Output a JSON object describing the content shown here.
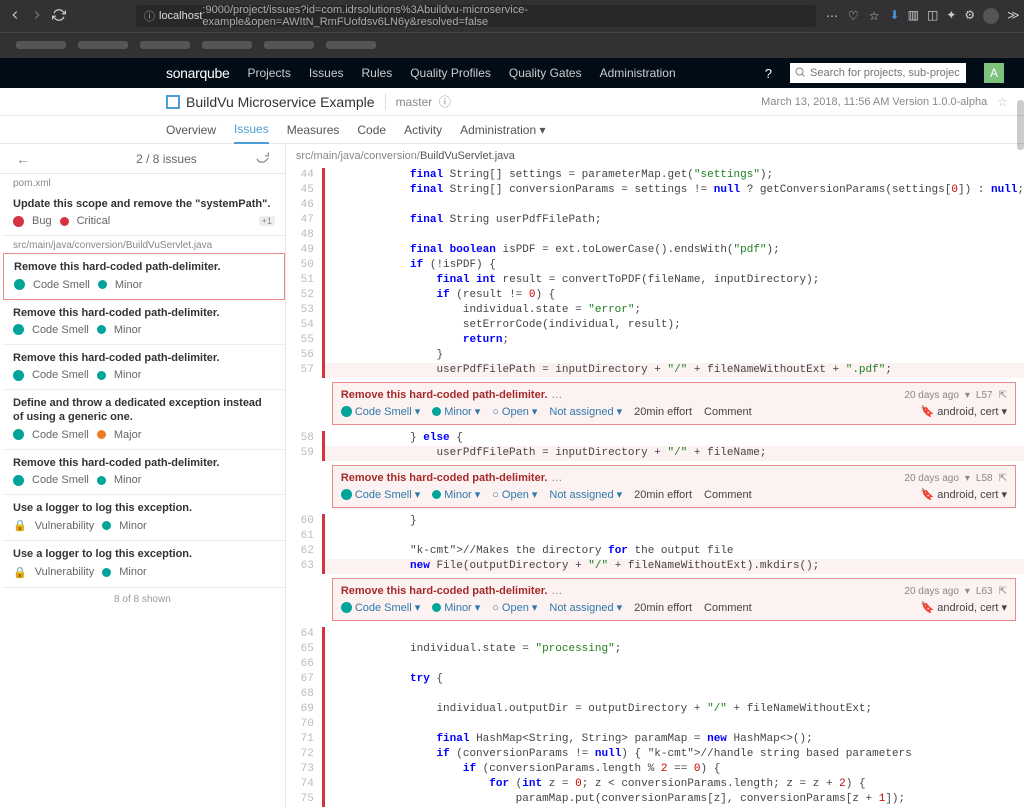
{
  "browser": {
    "url_prefix": "localhost",
    "url_rest": ":9000/project/issues?id=com.idrsolutions%3Abuildvu-microservice-example&open=AWItN_RmFUofdsv6LN6y&resolved=false"
  },
  "nav": {
    "brand": "sonarqube",
    "items": [
      "Projects",
      "Issues",
      "Rules",
      "Quality Profiles",
      "Quality Gates",
      "Administration"
    ],
    "search_placeholder": "Search for projects, sub-projects and files...",
    "avatar_letter": "A"
  },
  "project": {
    "name": "BuildVu Microservice Example",
    "branch": "master",
    "meta": "March 13, 2018, 11:56 AM   Version 1.0.0-alpha"
  },
  "subnav": [
    "Overview",
    "Issues",
    "Measures",
    "Code",
    "Activity",
    "Administration ▾"
  ],
  "issues_header": {
    "count": "2 / 8 issues"
  },
  "sidebar": {
    "file1": "pom.xml",
    "file2": "src/main/java/conversion/BuildVuServlet.java",
    "items": [
      {
        "title": "Update this scope and remove the \"systemPath\".",
        "type": "Bug",
        "type_icon": "red",
        "sev": "Critical",
        "sev_icon": "red",
        "badge": "+1"
      },
      {
        "title": "Remove this hard-coded path-delimiter.",
        "type": "Code Smell",
        "type_icon": "teal",
        "sev": "Minor",
        "sev_icon": "teal",
        "selected": true
      },
      {
        "title": "Remove this hard-coded path-delimiter.",
        "type": "Code Smell",
        "type_icon": "teal",
        "sev": "Minor",
        "sev_icon": "teal"
      },
      {
        "title": "Remove this hard-coded path-delimiter.",
        "type": "Code Smell",
        "type_icon": "teal",
        "sev": "Minor",
        "sev_icon": "teal"
      },
      {
        "title": "Define and throw a dedicated exception instead of using a generic one.",
        "type": "Code Smell",
        "type_icon": "teal",
        "sev": "Major",
        "sev_icon": "orange"
      },
      {
        "title": "Remove this hard-coded path-delimiter.",
        "type": "Code Smell",
        "type_icon": "teal",
        "sev": "Minor",
        "sev_icon": "teal"
      },
      {
        "title": "Use a logger to log this exception.",
        "type": "Vulnerability",
        "type_icon": "teal",
        "sev": "Minor",
        "sev_icon": "teal",
        "lock": true
      },
      {
        "title": "Use a logger to log this exception.",
        "type": "Vulnerability",
        "type_icon": "teal",
        "sev": "Minor",
        "sev_icon": "teal",
        "lock": true
      }
    ],
    "footer": "8 of 8 shown"
  },
  "file_open": {
    "path_prefix": "src/main/java/conversion/",
    "file": "BuildVuServlet.java"
  },
  "code": [
    {
      "n": 44,
      "bar": true,
      "t": "            final String[] settings = parameterMap.get(\"settings\");"
    },
    {
      "n": 45,
      "bar": true,
      "t": "            final String[] conversionParams = settings != null ? getConversionParams(settings[0]) : null;"
    },
    {
      "n": 46,
      "bar": true,
      "t": ""
    },
    {
      "n": 47,
      "bar": true,
      "t": "            final String userPdfFilePath;"
    },
    {
      "n": 48,
      "bar": true,
      "t": ""
    },
    {
      "n": 49,
      "bar": true,
      "t": "            final boolean isPDF = ext.toLowerCase().endsWith(\"pdf\");"
    },
    {
      "n": 50,
      "bar": true,
      "t": "            if (!isPDF) {"
    },
    {
      "n": 51,
      "bar": true,
      "t": "                final int result = convertToPDF(fileName, inputDirectory);"
    },
    {
      "n": 52,
      "bar": true,
      "t": "                if (result != 0) {"
    },
    {
      "n": 53,
      "bar": true,
      "t": "                    individual.state = \"error\";"
    },
    {
      "n": 54,
      "bar": true,
      "t": "                    setErrorCode(individual, result);"
    },
    {
      "n": 55,
      "bar": true,
      "t": "                    return;"
    },
    {
      "n": 56,
      "bar": true,
      "t": "                }"
    },
    {
      "n": 57,
      "bar": true,
      "hl": true,
      "t": "                userPdfFilePath = inputDirectory + \"/\" + fileNameWithoutExt + \".pdf\";"
    }
  ],
  "issue_box": {
    "title": "Remove this hard-coded path-delimiter.",
    "link": "…",
    "age": "20 days ago",
    "line_a": "L57",
    "line_b": "L58",
    "line_c": "L63",
    "type": "Code Smell",
    "sev": "Minor",
    "status": "Open",
    "assign": "Not assigned",
    "effort": "20min effort",
    "comment": "Comment",
    "tags": "android, cert"
  },
  "code2": [
    {
      "n": 58,
      "bar": true,
      "t": "            } else {"
    },
    {
      "n": 59,
      "bar": true,
      "hl": true,
      "t": "                userPdfFilePath = inputDirectory + \"/\" + fileName;"
    }
  ],
  "code3": [
    {
      "n": 60,
      "bar": true,
      "t": "            }"
    },
    {
      "n": 61,
      "bar": true,
      "t": ""
    },
    {
      "n": 62,
      "bar": true,
      "t": "            //Makes the directory for the output file"
    },
    {
      "n": 63,
      "bar": true,
      "hl": true,
      "t": "            new File(outputDirectory + \"/\" + fileNameWithoutExt).mkdirs();"
    }
  ],
  "code4": [
    {
      "n": 64,
      "bar": true,
      "t": ""
    },
    {
      "n": 65,
      "bar": true,
      "t": "            individual.state = \"processing\";"
    },
    {
      "n": 66,
      "bar": true,
      "t": ""
    },
    {
      "n": 67,
      "bar": true,
      "t": "            try {"
    },
    {
      "n": 68,
      "bar": true,
      "t": ""
    },
    {
      "n": 69,
      "bar": true,
      "t": "                individual.outputDir = outputDirectory + \"/\" + fileNameWithoutExt;"
    },
    {
      "n": 70,
      "bar": true,
      "t": ""
    },
    {
      "n": 71,
      "bar": true,
      "t": "                final HashMap<String, String> paramMap = new HashMap<>();"
    },
    {
      "n": 72,
      "bar": true,
      "t": "                if (conversionParams != null) { //handle string based parameters"
    },
    {
      "n": 73,
      "bar": true,
      "t": "                    if (conversionParams.length % 2 == 0) {"
    },
    {
      "n": 74,
      "bar": true,
      "t": "                        for (int z = 0; z < conversionParams.length; z = z + 2) {"
    },
    {
      "n": 75,
      "bar": true,
      "t": "                            paramMap.put(conversionParams[z], conversionParams[z + 1]);"
    }
  ]
}
